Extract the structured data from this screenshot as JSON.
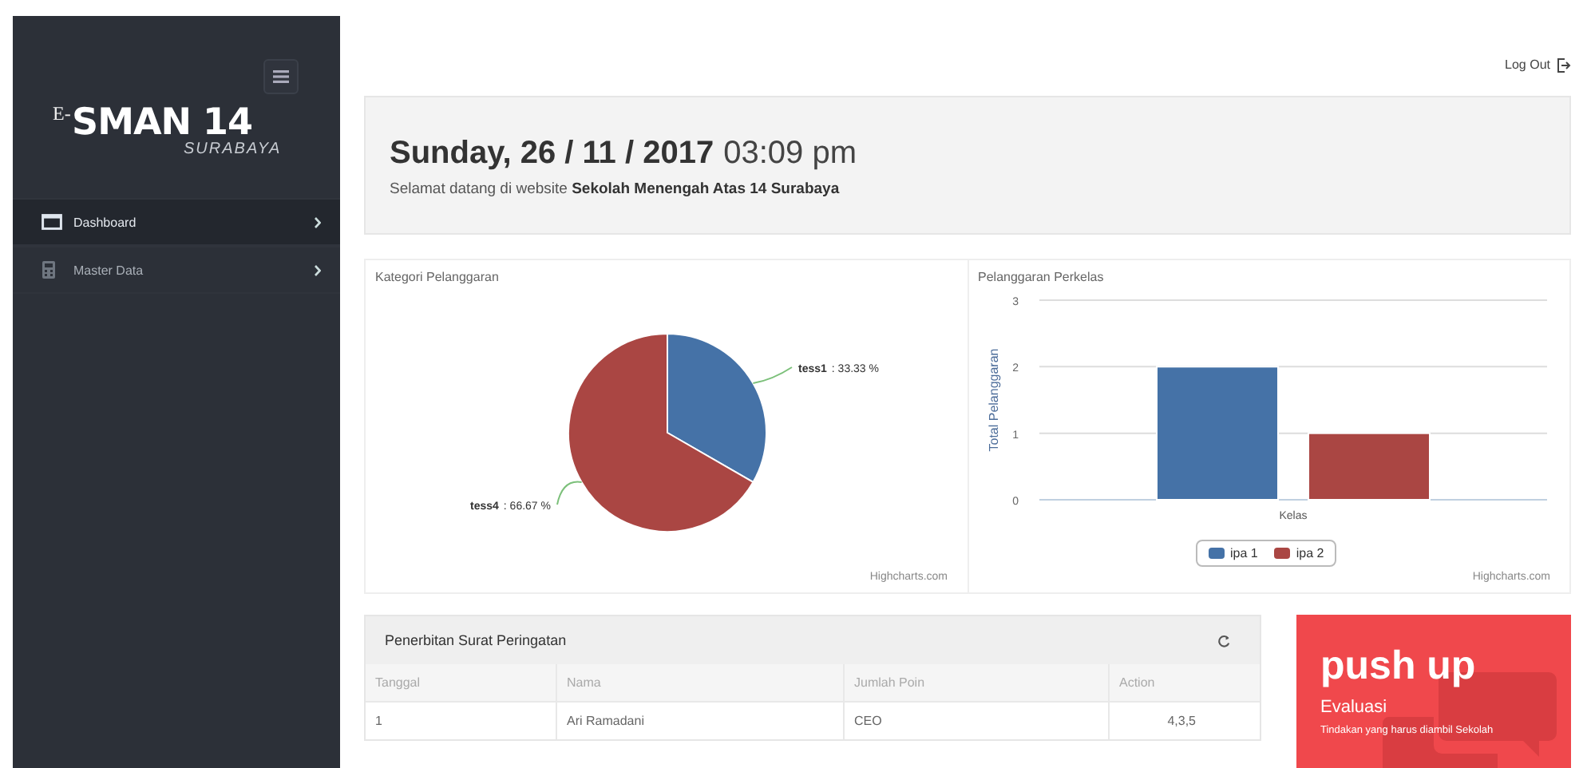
{
  "sidebar": {
    "logo": {
      "prefix": "E-",
      "title": "SMAN 14",
      "subtitle": "SURABAYA"
    },
    "items": [
      {
        "label": "Dashboard",
        "kind": "monitor",
        "selected": true
      },
      {
        "label": "Master Data",
        "kind": "calculator",
        "selected": false
      }
    ]
  },
  "topbar": {
    "logout": "Log Out"
  },
  "header": {
    "date": "Sunday, 26 / 11 / 2017",
    "time": "03:09 pm",
    "welcome": "Selamat datang di website **Sekolah Menengah Atas 14 Surabaya**"
  },
  "charts": [
    {
      "title": "Kategori Pelanggaran",
      "credits": "Highcharts.com",
      "chart_data": {
        "type": "pie",
        "categories": [
          "tess1",
          "tess4"
        ],
        "values": [
          33.33,
          66.67
        ],
        "value_labels": [
          ": 33.33 %",
          ": 66.67 %"
        ],
        "colors": [
          "#4572a7",
          "#aa4643"
        ]
      }
    },
    {
      "title": "Pelanggaran Perkelas",
      "credits": "Highcharts.com",
      "chart_data": {
        "type": "bar",
        "ylabel": "Total Pelanggaran",
        "categories": [
          "Kelas"
        ],
        "ylim": [
          0,
          3
        ],
        "yticks": [
          0,
          1,
          2,
          3
        ],
        "legend": "bottom",
        "series": [
          {
            "name": "ipa 1",
            "color": "#4572a7",
            "values": [
              2
            ]
          },
          {
            "name": "ipa 2",
            "color": "#aa4643",
            "values": [
              1
            ]
          }
        ]
      }
    }
  ],
  "table": {
    "title": "Penerbitan Surat Peringatan",
    "columns": [
      "Tanggal",
      "Nama",
      "Jumlah Poin",
      "Action"
    ],
    "rows": [
      [
        "1",
        "Ari Ramadani",
        "CEO",
        "4,3,5"
      ]
    ]
  },
  "promo": {
    "title": "push up",
    "subtitle": "Evaluasi",
    "text": "Tindakan yang harus diambil Sekolah"
  }
}
